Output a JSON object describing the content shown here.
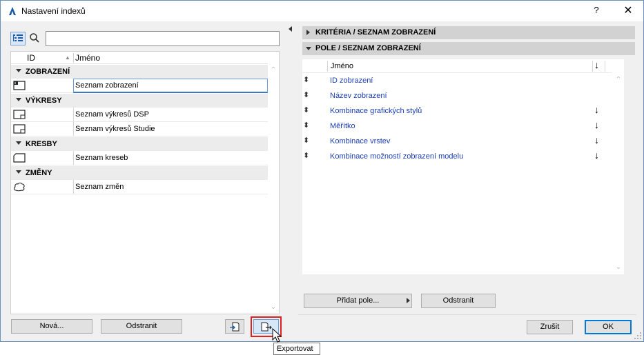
{
  "window": {
    "title": "Nastavení indexů",
    "help_label": "?",
    "close_label": "✕"
  },
  "left": {
    "search_value": "",
    "columns": {
      "id": "ID",
      "name": "Jméno"
    },
    "groups": [
      {
        "label": "ZOBRAZENÍ",
        "rows": [
          {
            "id": "",
            "name": "Seznam zobrazení",
            "icon": "view-list-icon",
            "selected": true
          }
        ]
      },
      {
        "label": "VÝKRESY",
        "rows": [
          {
            "id": "",
            "name": "Seznam výkresů DSP",
            "icon": "drawing-sheet-icon"
          },
          {
            "id": "",
            "name": "Seznam výkresů Studie",
            "icon": "drawing-sheet-icon"
          }
        ]
      },
      {
        "label": "KRESBY",
        "rows": [
          {
            "id": "",
            "name": "Seznam kreseb",
            "icon": "sketch-icon"
          }
        ]
      },
      {
        "label": "ZMĚNY",
        "rows": [
          {
            "id": "",
            "name": "Seznam změn",
            "icon": "cloud-icon"
          }
        ]
      }
    ],
    "buttons": {
      "new": "Nová...",
      "delete": "Odstranit"
    }
  },
  "right": {
    "sections": [
      {
        "label": "KRITÉRIA / SEZNAM ZOBRAZENÍ",
        "expanded": false
      },
      {
        "label": "POLE / SEZNAM ZOBRAZENÍ",
        "expanded": true
      }
    ],
    "field_header": {
      "name": "Jméno",
      "sort": "↓"
    },
    "fields": [
      {
        "name": "ID zobrazení",
        "sort": ""
      },
      {
        "name": "Název zobrazení",
        "sort": ""
      },
      {
        "name": "Kombinace grafických stylů",
        "sort": "↓"
      },
      {
        "name": "Měřítko",
        "sort": "↓"
      },
      {
        "name": "Kombinace vrstev",
        "sort": "↓"
      },
      {
        "name": "Kombinace možností zobrazení modelu",
        "sort": "↓"
      }
    ],
    "buttons": {
      "add_field": "Přidat pole...",
      "remove": "Odstranit"
    }
  },
  "footer": {
    "cancel": "Zrušit",
    "ok": "OK"
  },
  "tooltip": "Exportovat",
  "colors": {
    "link": "#1b3eb0",
    "highlight": "#e02020",
    "section": "#d2d2d2"
  }
}
